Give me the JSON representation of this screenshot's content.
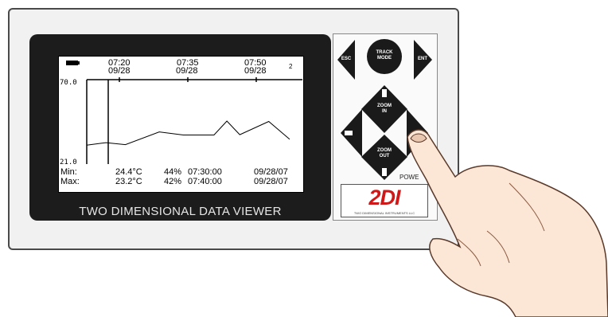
{
  "screen": {
    "times": [
      {
        "time": "07:20",
        "date": "09/28"
      },
      {
        "time": "07:35",
        "date": "09/28"
      },
      {
        "time": "07:50",
        "date": "09/28"
      }
    ],
    "zoom_indicator": "2",
    "y_top": "70.0",
    "y_bottom": "21.0",
    "stats": [
      {
        "label": "Min:",
        "temp": "24.4°C",
        "humidity": "44%",
        "time": "07:30:00",
        "date": "09/28/07"
      },
      {
        "label": "Max:",
        "temp": "23.2°C",
        "humidity": "42%",
        "time": "07:40:00",
        "date": "09/28/07"
      }
    ],
    "trace": [
      [
        0,
        30.5
      ],
      [
        0.12,
        32.0
      ],
      [
        0.24,
        30.8
      ],
      [
        0.45,
        38.5
      ],
      [
        0.6,
        36.6
      ],
      [
        0.79,
        36.6
      ],
      [
        0.87,
        45.0
      ],
      [
        0.95,
        36.8
      ],
      [
        1.13,
        44.8
      ],
      [
        1.26,
        34.0
      ]
    ]
  },
  "bezel_label": "TWO DIMENSIONAL DATA VIEWER",
  "keypad": {
    "esc": "ESC",
    "track_mode": [
      "TRACK",
      "MODE"
    ],
    "ent": "ENT",
    "zoom_in": [
      "ZOOM",
      "IN"
    ],
    "zoom_out": [
      "ZOOM",
      "OUT"
    ],
    "power_label": "POWE",
    "logo_text": "2DI",
    "logo_subtext": "TWO DIMENSIONAL INSTRUMENTS LLC"
  },
  "colors": {
    "bezel": "#1c1c1c",
    "logo": "#d11818",
    "hand": "#fce6d6",
    "hand_outline": "#5a3a2a"
  }
}
